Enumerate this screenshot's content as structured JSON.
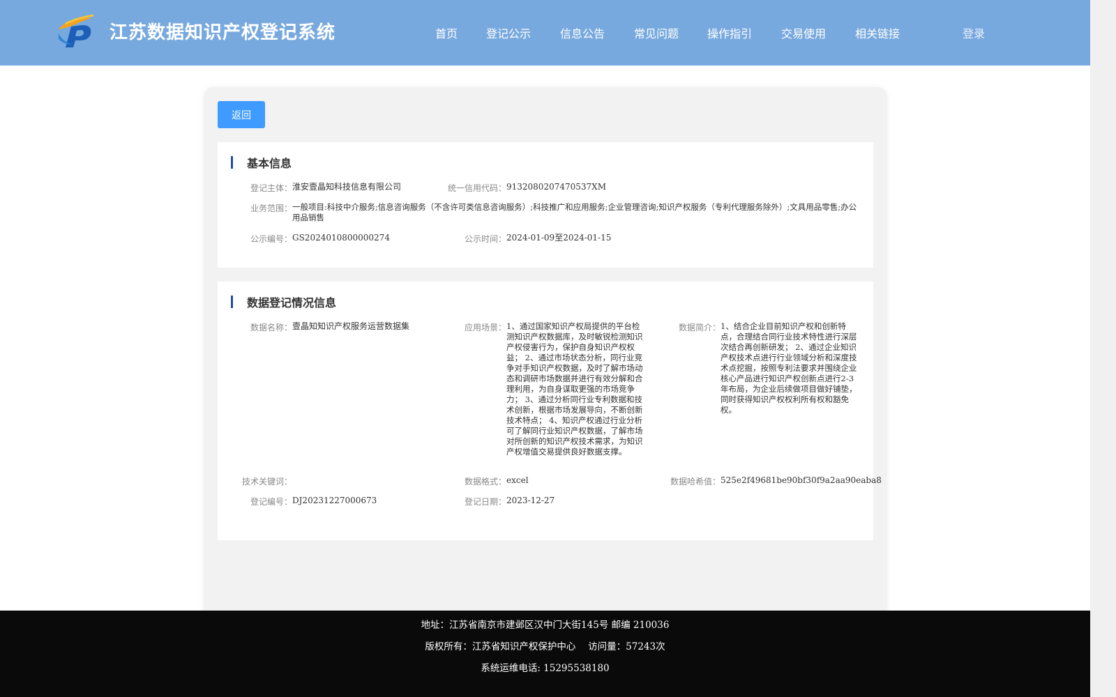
{
  "header": {
    "site_title": "江苏数据知识产权登记系统",
    "nav": [
      "首页",
      "登记公示",
      "信息公告",
      "常见问题",
      "操作指引",
      "交易使用",
      "相关链接"
    ],
    "login": "登录"
  },
  "back_button": "返回",
  "basic_info": {
    "title": "基本信息",
    "registrant_label": "登记主体：",
    "registrant_value": "淮安壹晶知科技信息有限公司",
    "credit_code_label": "统一信用代码：",
    "credit_code_value": "9132080207470537XM",
    "business_scope_label": "业务范围：",
    "business_scope_value": "一般项目:科技中介服务;信息咨询服务（不含许可类信息咨询服务）;科技推广和应用服务;企业管理咨询;知识产权服务（专利代理服务除外）;文具用品零售;办公用品销售",
    "publicity_no_label": "公示编号：",
    "publicity_no_value": "GS2024010800000274",
    "publicity_time_label": "公示时间：",
    "publicity_time_value": "2024-01-09至2024-01-15"
  },
  "data_info": {
    "title": "数据登记情况信息",
    "data_name_label": "数据名称：",
    "data_name_value": "壹晶知知识产权服务运营数据集",
    "scenario_label": "应用场景：",
    "scenario_value": "1、通过国家知识产权局提供的平台检测知识产权数据库，及时敏锐检测知识产权侵害行为，保护自身知识产权权益； 2、通过市场状态分析，同行业竞争对手知识产权数据，及时了解市场动态和调研市场数据并进行有效分解和合理利用，为自身谋取更强的市场竞争力； 3、通过分析同行业专利数据和技术创新，根据市场发展导向，不断创新技术特点； 4、知识产权通过行业分析可了解同行业知识产权数据，了解市场对所创新的知识产权技术需求，为知识产权增值交易提供良好数据支撑。",
    "summary_label": "数据简介：",
    "summary_value": "1、结合企业目前知识产权和创新特点，合理结合同行业技术特性进行深层次结合再创新研发； 2、通过企业知识产权技术点进行行业领域分析和深度技术点挖掘，按照专利法要求并围绕企业核心产品进行知识产权创新点进行2-3年布局，为企业后续做项目做好铺垫，同时获得知识产权权利所有权和豁免权。",
    "keywords_label": "技术关键词：",
    "keywords_value": "",
    "format_label": "数据格式：",
    "format_value": "excel",
    "hash_label": "数据哈希值：",
    "hash_value": "525e2f49681be90bf30f9a2aa90eaba8",
    "reg_no_label": "登记编号：",
    "reg_no_value": "DJ20231227000673",
    "reg_date_label": "登记日期：",
    "reg_date_value": "2023-12-27"
  },
  "footer": {
    "address": "地址：江苏省南京市建邺区汉中门大街145号 邮编 210036",
    "copyright": "版权所有：江苏省知识产权保护中心　 访问量：57243次",
    "phone": "系统运维电话: 15295538180"
  },
  "colors": {
    "header_bg": "#78a9de",
    "button_blue": "#3f9bff",
    "section_bar": "#1f4f9c",
    "footer_bg": "#0a0a0a"
  }
}
